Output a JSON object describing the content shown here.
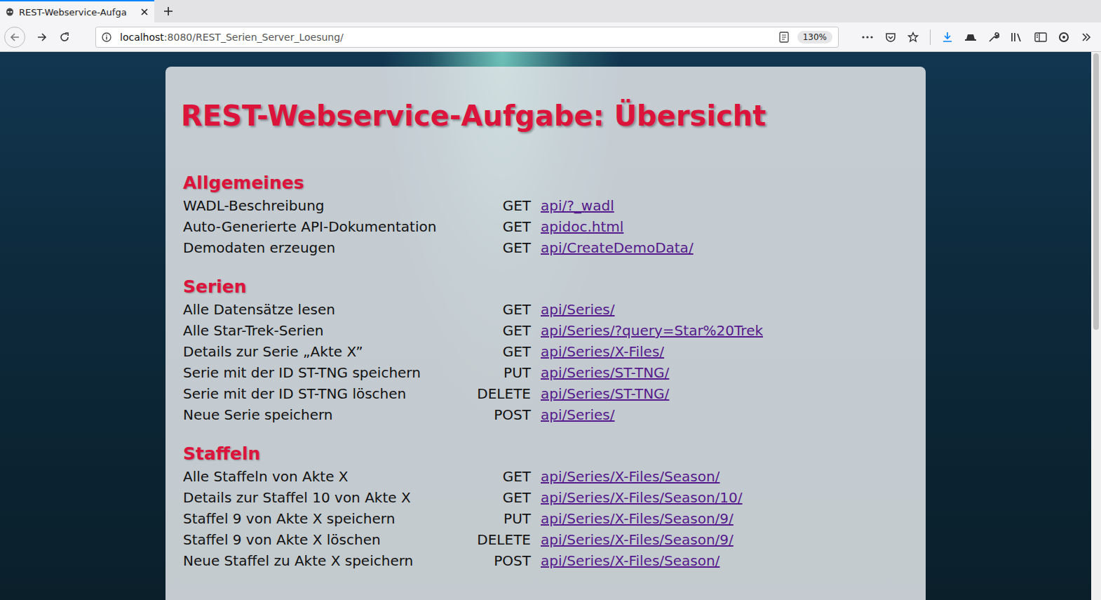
{
  "browser": {
    "tab": {
      "label": "REST-Webservice-Aufga",
      "selected": true
    },
    "url": {
      "host": "localhost",
      "path": ":8080/REST_Serien_Server_Loesung/"
    },
    "zoom": "130%"
  },
  "page": {
    "title": "REST-Webservice-Aufgabe: Übersicht",
    "sections": [
      {
        "title": "Allgemeines",
        "rows": [
          {
            "label": "WADL-Beschreibung",
            "method": "GET",
            "path": "api/?_wadl"
          },
          {
            "label": "Auto-Generierte API-Dokumentation",
            "method": "GET",
            "path": "apidoc.html"
          },
          {
            "label": "Demodaten erzeugen",
            "method": "GET",
            "path": "api/CreateDemoData/"
          }
        ]
      },
      {
        "title": "Serien",
        "rows": [
          {
            "label": "Alle Datensätze lesen",
            "method": "GET",
            "path": "api/Series/"
          },
          {
            "label": "Alle Star-Trek-Serien",
            "method": "GET",
            "path": "api/Series/?query=Star%20Trek"
          },
          {
            "label": "Details zur Serie „Akte X”",
            "method": "GET",
            "path": "api/Series/X-Files/"
          },
          {
            "label": "Serie mit der ID ST-TNG speichern",
            "method": "PUT",
            "path": "api/Series/ST-TNG/"
          },
          {
            "label": "Serie mit der ID ST-TNG löschen",
            "method": "DELETE",
            "path": "api/Series/ST-TNG/"
          },
          {
            "label": "Neue Serie speichern",
            "method": "POST",
            "path": "api/Series/"
          }
        ]
      },
      {
        "title": "Staffeln",
        "rows": [
          {
            "label": "Alle Staffeln von Akte X",
            "method": "GET",
            "path": "api/Series/X-Files/Season/"
          },
          {
            "label": "Details zur Staffel 10 von Akte X",
            "method": "GET",
            "path": "api/Series/X-Files/Season/10/"
          },
          {
            "label": "Staffel 9 von Akte X speichern",
            "method": "PUT",
            "path": "api/Series/X-Files/Season/9/"
          },
          {
            "label": "Staffel 9 von Akte X löschen",
            "method": "DELETE",
            "path": "api/Series/X-Files/Season/9/"
          },
          {
            "label": "Neue Staffel zu Akte X speichern",
            "method": "POST",
            "path": "api/Series/X-Files/Season/"
          }
        ]
      }
    ]
  }
}
